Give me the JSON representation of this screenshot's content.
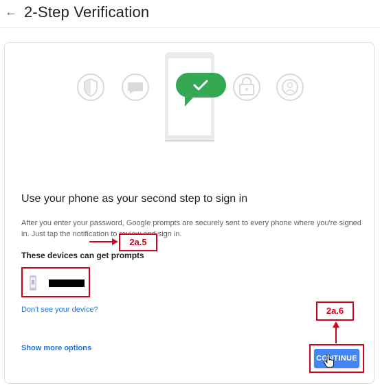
{
  "header": {
    "back_icon": "arrow-left-icon",
    "title": "2-Step Verification"
  },
  "illustration": {
    "icons": [
      "shield-icon",
      "message-bubble-icon",
      "phone-check-icon",
      "lock-icon",
      "account-circle-icon"
    ],
    "accent_green": "#34a853"
  },
  "content": {
    "headline": "Use your phone as your second step to sign in",
    "description": "After you enter your password, Google prompts are securely sent to every phone where you're signed in. Just tap the notification to review and sign in.",
    "devices_heading": "These devices can get prompts",
    "device_name_redacted": true,
    "dont_see_device_link": "Don't see your device?",
    "show_more_link": "Show more options",
    "continue_button": "CONTINUE"
  },
  "annotations": {
    "device_callout": "2a.5",
    "continue_callout": "2a.6",
    "annotation_color": "#d0021b"
  },
  "colors": {
    "link": "#1a73e8",
    "button": "#4285f4"
  }
}
